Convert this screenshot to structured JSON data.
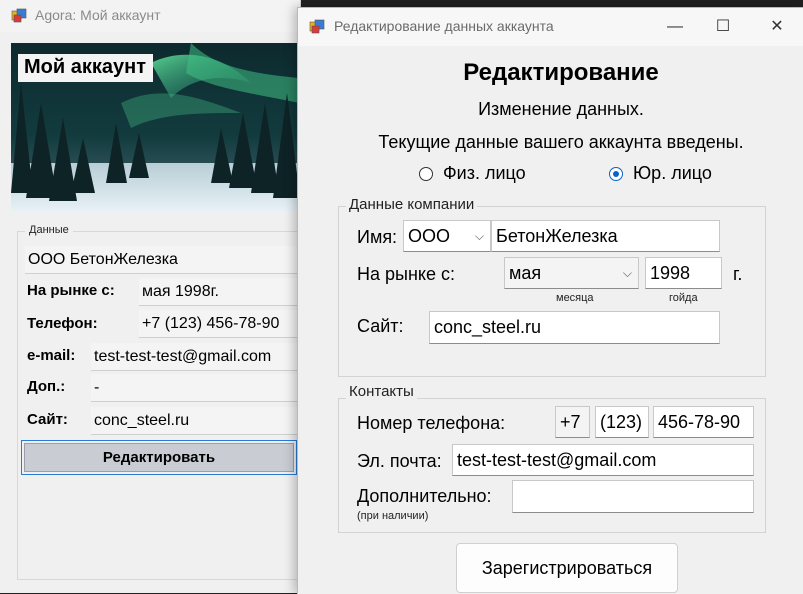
{
  "back_window": {
    "title": "Agora: Мой аккаунт",
    "banner_title": "Мой аккаунт",
    "group_label": "Данные",
    "company_name": "ООО БетонЖелезка",
    "rows": [
      {
        "label": "На рынке с:",
        "value": "мая 1998г."
      },
      {
        "label": "Телефон:",
        "value": "+7 (123) 456-78-90"
      },
      {
        "label": "e-mail:",
        "value": "test-test-test@gmail.com"
      },
      {
        "label": "Доп.:",
        "value": "-"
      },
      {
        "label": "Сайт:",
        "value": "conc_steel.ru"
      }
    ],
    "edit_button": "Редактировать"
  },
  "dialog": {
    "title": "Редактирование данных аккаунта",
    "controls": {
      "minimize": "—",
      "maximize": "☐",
      "close": "✕"
    },
    "heading": "Редактирование",
    "subtitle1": "Изменение данных.",
    "subtitle2": "Текущие данные вашего аккаунта введены.",
    "radio_individual": "Физ. лицо",
    "radio_legal": "Юр. лицо",
    "radio_selected": "legal",
    "company_group": {
      "title": "Данные компании",
      "name_label": "Имя:",
      "legal_form": "ООО",
      "name_value": "БетонЖелезка",
      "market_label": "На рынке с:",
      "month_value": "мая",
      "month_caption": "месяца",
      "year_value": "1998",
      "year_caption": "гойда",
      "year_suffix": "г.",
      "site_label": "Сайт:",
      "site_value": "conc_steel.ru"
    },
    "contacts_group": {
      "title": "Контакты",
      "phone_label": "Номер телефона:",
      "phone_country": "+7",
      "phone_code": "(123)",
      "phone_number": "456-78-90",
      "email_label": "Эл. почта:",
      "email_value": "test-test-test@gmail.com",
      "extra_label": "Дополнительно:",
      "extra_hint": "(при наличии)",
      "extra_value": ""
    },
    "register_button": "Зарегистрироваться"
  }
}
